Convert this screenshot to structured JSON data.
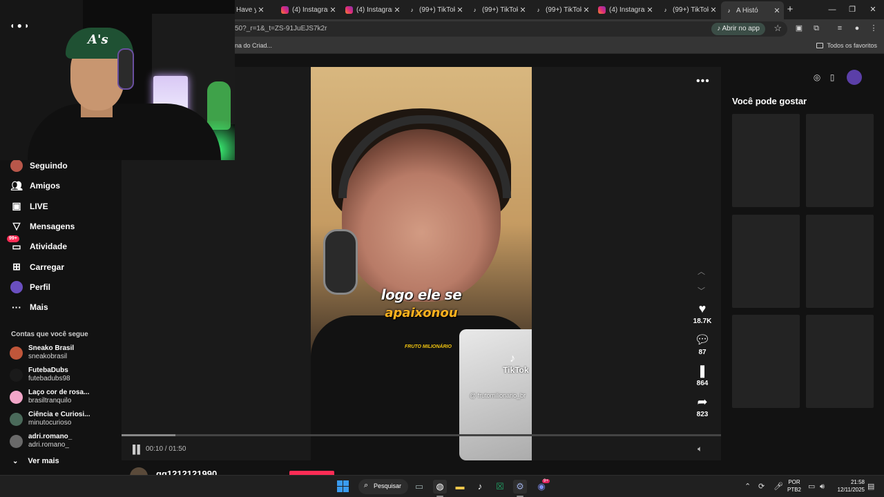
{
  "browser": {
    "tabs": [
      {
        "title": "Have y",
        "icon": "generic-tab-icon",
        "type": "none"
      },
      {
        "title": "(4) Instagram",
        "icon": "instagram-icon",
        "type": "ig"
      },
      {
        "title": "(4) Instagram",
        "icon": "instagram-icon",
        "type": "ig"
      },
      {
        "title": "(99+) TikTok",
        "icon": "tiktok-icon",
        "type": "tt"
      },
      {
        "title": "(99+) TikTok",
        "icon": "tiktok-icon",
        "type": "tt"
      },
      {
        "title": "(99+) TikTok",
        "icon": "tiktok-icon",
        "type": "tt"
      },
      {
        "title": "(4) Instagram",
        "icon": "instagram-icon",
        "type": "ig"
      },
      {
        "title": "(99+) TikTok",
        "icon": "tiktok-icon",
        "type": "tt"
      },
      {
        "title": "A Histó",
        "icon": "tiktok-icon",
        "type": "tt",
        "active": true
      }
    ],
    "new_tab": "+",
    "window_controls": {
      "minimize": "—",
      "maximize": "❐",
      "close": "✕"
    },
    "url": "50?_r=1&_t=ZS-91JuEJS7k2r",
    "open_app_label": "Abrir no app",
    "bookmark_item": "na do Criad...",
    "bookmarks_all": "Todos os favoritos"
  },
  "sidebar": {
    "items": [
      {
        "label": "Seguindo",
        "icon": "avatar-icon"
      },
      {
        "label": "Amigos",
        "icon": "friends-icon"
      },
      {
        "label": "LIVE",
        "icon": "live-icon"
      },
      {
        "label": "Mensagens",
        "icon": "messages-icon"
      },
      {
        "label": "Atividade",
        "icon": "activity-icon",
        "badge": "99+"
      },
      {
        "label": "Carregar",
        "icon": "upload-icon"
      },
      {
        "label": "Perfil",
        "icon": "profile-icon"
      },
      {
        "label": "Mais",
        "icon": "more-icon"
      }
    ],
    "following_title": "Contas que você segue",
    "accounts": [
      {
        "name": "Sneako Brasil",
        "user": "sneakobrasil",
        "color": "#c0563a"
      },
      {
        "name": "FutebaDubs",
        "user": "futebadubs98",
        "color": "#1a1a1a"
      },
      {
        "name": "Laço cor de rosa...",
        "user": "brasiltranquilo",
        "color": "#f2a6c8"
      },
      {
        "name": "Ciência e Curiosi...",
        "user": "minutocurioso",
        "color": "#4a6a5a"
      },
      {
        "name": "adri.romano_",
        "user": "adri.romano_",
        "color": "#6a6a6a"
      }
    ],
    "see_more": "Ver mais"
  },
  "video": {
    "caption_line1": "logo ele se",
    "caption_line2": "apaixonou",
    "logo_text": "FRUTO MILIONÁRIO",
    "watermark": "TikTok",
    "handle": "@ frutomilionario_br",
    "likes": "18.7K",
    "comments": "87",
    "saves": "864",
    "shares": "823",
    "time": "00:10 / 01:50",
    "progress": 0.09
  },
  "next_video": {
    "username": "gg1212121990"
  },
  "right_panel": {
    "title": "Você pode gostar",
    "thumb_count": 6
  },
  "taskbar": {
    "search_label": "Pesquisar",
    "lang_line1": "POR",
    "lang_line2": "PTB2",
    "time": "21:58",
    "date": "12/11/2025",
    "discord_badge": "9+"
  },
  "colors": {
    "accent": "#fe2c55",
    "caption_orange": "#ffb21e",
    "page_bg": "#121212"
  }
}
